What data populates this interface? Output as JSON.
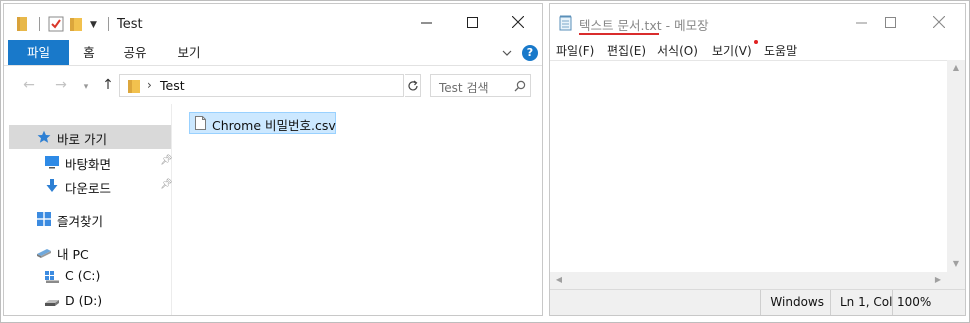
{
  "explorer": {
    "title": "Test",
    "ribbon_tabs": [
      "파일",
      "홈",
      "공유",
      "보기"
    ],
    "help_label": "?",
    "address": {
      "path": "Test"
    },
    "search": {
      "placeholder": "Test 검색"
    },
    "nav_pane": {
      "quick_access": "바로 가기",
      "desktop": "바탕화면",
      "downloads": "다운로드",
      "favorites": "즐겨찾기",
      "this_pc": "내 PC",
      "drive_c": "C (C:)",
      "drive_d": "D (D:)"
    },
    "files": [
      {
        "name": "Chrome 비밀번호.csv",
        "selected": true
      }
    ]
  },
  "notepad": {
    "title": "텍스트 문서.txt - 메모장",
    "menu": [
      "파일(F)",
      "편집(E)",
      "서식(O)",
      "보기(V)",
      "도움말"
    ],
    "content": "",
    "status": {
      "line_ending": "Windows",
      "position": "Ln 1, Col",
      "zoom": "100%"
    }
  },
  "colors": {
    "ribbon_file_tab": "#1979ca",
    "selection_fill": "#cce8ff",
    "selection_border": "#99d1ff",
    "title_annotation_underline": "#d92c2c"
  },
  "icons": [
    "folder-icon",
    "properties-icon",
    "minimize-icon",
    "maximize-icon",
    "close-icon",
    "help-icon",
    "back-arrow-icon",
    "forward-arrow-icon",
    "up-arrow-icon",
    "refresh-icon",
    "search-icon",
    "star-icon",
    "desktop-icon",
    "download-icon",
    "pin-icon",
    "grid-icon",
    "computer-icon",
    "drive-icon",
    "csv-file-icon",
    "notepad-icon"
  ]
}
